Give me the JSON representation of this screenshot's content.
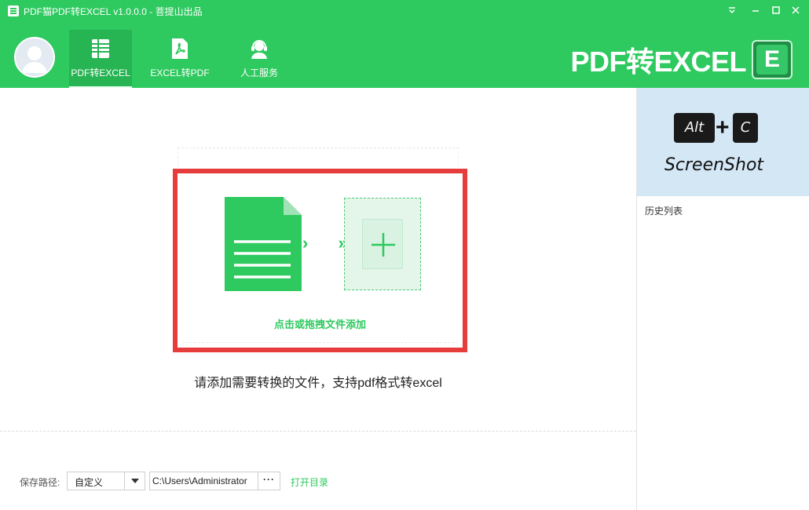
{
  "window": {
    "title": "PDF猫PDF转EXCEL v1.0.0.0 - 菩提山出品",
    "controls": [
      "dropdown-arrow-icon",
      "minimize-icon",
      "maximize-icon",
      "close-icon"
    ]
  },
  "nav": {
    "items": [
      {
        "label": "PDF转EXCEL",
        "icon": "spreadsheet-icon",
        "active": true
      },
      {
        "label": "EXCEL转PDF",
        "icon": "pdf-icon",
        "active": false
      },
      {
        "label": "人工服务",
        "icon": "headset-icon",
        "active": false
      }
    ]
  },
  "brand": {
    "text": "PDF转EXCEL",
    "logo_letter": "E"
  },
  "main": {
    "drop_hint": "点击或拖拽文件添加",
    "arrows": "› »",
    "instruction": "请添加需要转换的文件，支持pdf格式转excel"
  },
  "save": {
    "label": "保存路径:",
    "mode_value": "自定义",
    "path_value": "C:\\Users\\Administrator",
    "browse_label": "···",
    "open_dir_label": "打开目录"
  },
  "sidebar": {
    "banner": {
      "key1": "Alt",
      "plus": "+",
      "key2": "C",
      "caption": "ScreenShot"
    },
    "history_label": "历史列表"
  },
  "colors": {
    "accent_green": "#2ec95f",
    "highlight_red": "#e63c3c",
    "banner_blue": "#d4e7f5"
  }
}
